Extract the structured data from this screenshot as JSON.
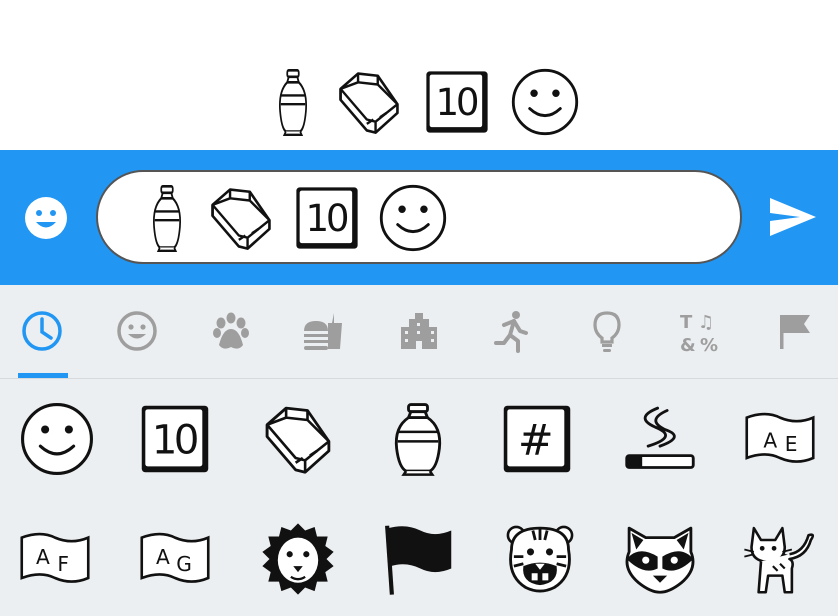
{
  "colors": {
    "accent": "#2196f3",
    "panel_bg": "#eceff1",
    "tab_inactive": "#9e9e9e",
    "send": "#ffffff"
  },
  "preview": {
    "emojis": [
      "funeral-urn",
      "coffin",
      "keycap-ten",
      "slightly-smiling-face"
    ]
  },
  "composer": {
    "emoji_button_icon": "smiley-icon",
    "input_emojis": [
      "funeral-urn",
      "coffin",
      "keycap-ten",
      "slightly-smiling-face"
    ],
    "send_icon": "send-icon"
  },
  "tabs": [
    {
      "name": "recent",
      "icon": "clock-icon",
      "active": true
    },
    {
      "name": "smileys",
      "icon": "smiley-icon",
      "active": false
    },
    {
      "name": "animals",
      "icon": "paw-icon",
      "active": false
    },
    {
      "name": "food",
      "icon": "food-icon",
      "active": false
    },
    {
      "name": "travel",
      "icon": "buildings-icon",
      "active": false
    },
    {
      "name": "activities",
      "icon": "runner-icon",
      "active": false
    },
    {
      "name": "objects",
      "icon": "lightbulb-icon",
      "active": false
    },
    {
      "name": "symbols",
      "icon": "symbols-icon",
      "active": false
    },
    {
      "name": "flags",
      "icon": "flag-icon",
      "active": false
    }
  ],
  "grid": {
    "row1": [
      "slightly-smiling-face",
      "keycap-ten",
      "coffin",
      "funeral-urn",
      "keycap-hash",
      "cigarette",
      "flag-ae"
    ],
    "row2": [
      "flag-af",
      "flag-ag",
      "lion-face",
      "black-flag",
      "tiger-face",
      "raccoon",
      "cat"
    ]
  },
  "labels": {
    "keycap_ten": "10",
    "keycap_hash": "#",
    "flag_ae": "AE",
    "flag_af": "AF",
    "flag_ag": "AG"
  }
}
